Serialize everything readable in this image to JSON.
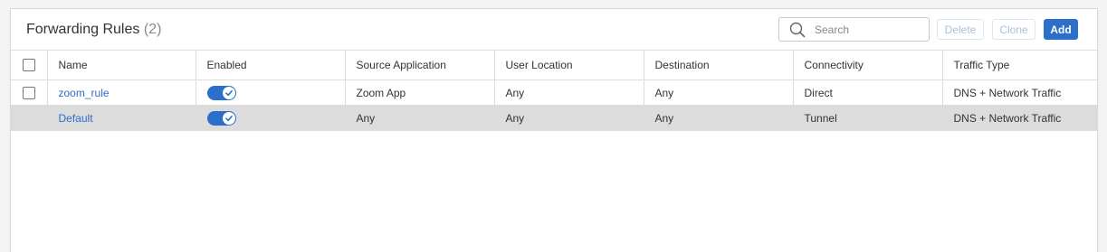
{
  "header": {
    "title": "Forwarding Rules",
    "count": "(2)"
  },
  "search": {
    "placeholder": "Search",
    "icon": "search-icon"
  },
  "toolbar": {
    "delete_label": "Delete",
    "clone_label": "Clone",
    "add_label": "Add"
  },
  "colors": {
    "accent": "#2b6fc9",
    "selected_row": "#dcdcdc",
    "disabled_text": "#a9c1dd"
  },
  "table": {
    "columns": {
      "name": "Name",
      "enabled": "Enabled",
      "source_application": "Source Application",
      "user_location": "User Location",
      "destination": "Destination",
      "connectivity": "Connectivity",
      "traffic_type": "Traffic Type"
    },
    "rows": [
      {
        "name": "zoom_rule",
        "enabled": true,
        "source_application": "Zoom App",
        "user_location": "Any",
        "destination": "Any",
        "connectivity": "Direct",
        "traffic_type": "DNS + Network Traffic"
      },
      {
        "name": "Default",
        "enabled": true,
        "source_application": "Any",
        "user_location": "Any",
        "destination": "Any",
        "connectivity": "Tunnel",
        "traffic_type": "DNS + Network Traffic"
      }
    ]
  }
}
